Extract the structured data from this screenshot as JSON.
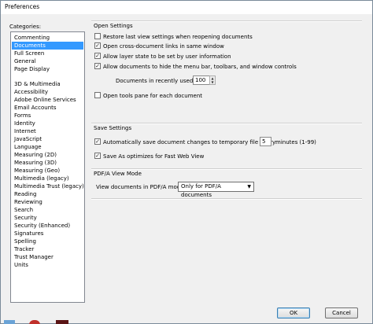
{
  "window": {
    "title": "Preferences"
  },
  "categories": {
    "label": "Categories:",
    "group1": [
      {
        "label": "Commenting",
        "selected": false
      },
      {
        "label": "Documents",
        "selected": true
      },
      {
        "label": "Full Screen",
        "selected": false
      },
      {
        "label": "General",
        "selected": false
      },
      {
        "label": "Page Display",
        "selected": false
      }
    ],
    "group2": [
      "3D & Multimedia",
      "Accessibility",
      "Adobe Online Services",
      "Email Accounts",
      "Forms",
      "Identity",
      "Internet",
      "JavaScript",
      "Language",
      "Measuring (2D)",
      "Measuring (3D)",
      "Measuring (Geo)",
      "Multimedia (legacy)",
      "Multimedia Trust (legacy)",
      "Reading",
      "Reviewing",
      "Search",
      "Security",
      "Security (Enhanced)",
      "Signatures",
      "Spelling",
      "Tracker",
      "Trust Manager",
      "Units"
    ]
  },
  "open_settings": {
    "title": "Open Settings",
    "restore_last_view": {
      "label": "Restore last view settings when reopening documents",
      "checked": false
    },
    "open_cross_doc": {
      "label": "Open cross-document links in same window",
      "checked": true
    },
    "allow_layer_state": {
      "label": "Allow layer state to be set by user information",
      "checked": true
    },
    "allow_hide_menu": {
      "label": "Allow documents to hide the menu bar, toolbars, and window controls",
      "checked": true
    },
    "recent_list_label": "Documents in recently used list:",
    "recent_list_value": "100",
    "open_tools_pane": {
      "label": "Open tools pane for each document",
      "checked": false
    }
  },
  "save_settings": {
    "title": "Save Settings",
    "autosave": {
      "label": "Automatically save document changes to temporary file every:",
      "checked": true
    },
    "autosave_value": "5",
    "autosave_unit": "minutes (1-99)",
    "fast_web_view": {
      "label": "Save As optimizes for Fast Web View",
      "checked": true
    }
  },
  "pdfa": {
    "title": "PDF/A View Mode",
    "view_label": "View documents in PDF/A mode:",
    "view_value": "Only for PDF/A documents"
  },
  "buttons": {
    "ok": "OK",
    "cancel": "Cancel"
  },
  "check_glyph": "✓"
}
